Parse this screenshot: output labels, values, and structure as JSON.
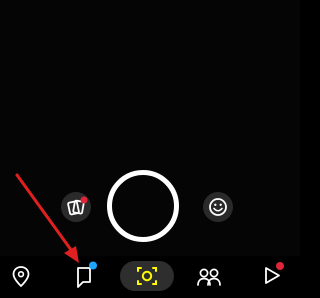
{
  "camera": {
    "shutter": "shutter-button",
    "memories": {
      "icon": "memories-icon",
      "badge_color": "#e0243a"
    },
    "lens": {
      "icon": "smiley-lens-icon"
    }
  },
  "bottom_nav": {
    "items": [
      {
        "id": "map",
        "icon": "map-pin-icon"
      },
      {
        "id": "chat",
        "icon": "chat-icon",
        "badge_color": "#1ea7ff"
      },
      {
        "id": "camera",
        "icon": "camera-scan-icon",
        "active": true,
        "accent": "#fffc00"
      },
      {
        "id": "stories",
        "icon": "friends-icon"
      },
      {
        "id": "spotlight",
        "icon": "play-icon",
        "badge_color": "#e0243a"
      }
    ]
  },
  "annotation": {
    "type": "arrow",
    "color": "#e02020",
    "points_to": "chat"
  }
}
